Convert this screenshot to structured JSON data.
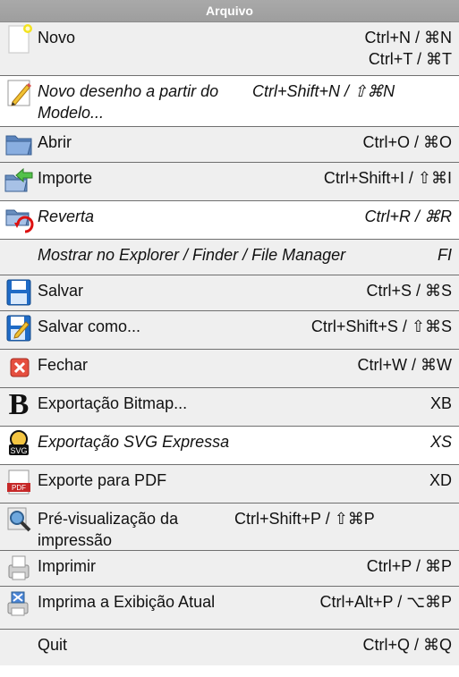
{
  "menu": {
    "title": "Arquivo",
    "items": [
      {
        "label": "Novo",
        "shortcut": "Ctrl+N / ⌘N\nCtrl+T / ⌘T",
        "icon": "new-document-icon",
        "italic": false
      },
      {
        "label": "Novo desenho a partir do Modelo...",
        "shortcut": "Ctrl+Shift+N / ⇧⌘N",
        "icon": "pencil-template-icon",
        "italic": true
      },
      {
        "label": "Abrir",
        "shortcut": "Ctrl+O / ⌘O",
        "icon": "open-folder-icon",
        "italic": false
      },
      {
        "label": "Importe",
        "shortcut": "Ctrl+Shift+I / ⇧⌘I",
        "icon": "import-arrow-folder-icon",
        "italic": false
      },
      {
        "label": "Reverta",
        "shortcut": "Ctrl+R / ⌘R",
        "icon": "revert-icon",
        "italic": true
      },
      {
        "label": "Mostrar no Explorer / Finder / File Manager",
        "shortcut": "FI",
        "icon": "",
        "italic": true
      },
      {
        "label": "Salvar",
        "shortcut": "Ctrl+S / ⌘S",
        "icon": "save-disk-icon",
        "italic": false
      },
      {
        "label": "Salvar como...",
        "shortcut": "Ctrl+Shift+S / ⇧⌘S",
        "icon": "save-as-icon",
        "italic": false
      },
      {
        "label": "Fechar",
        "shortcut": "Ctrl+W / ⌘W",
        "icon": "close-x-icon",
        "italic": false
      },
      {
        "label": "Exportação Bitmap...",
        "shortcut": "XB",
        "icon": "bitmap-b-icon",
        "italic": false
      },
      {
        "label": "Exportação SVG Expressa",
        "shortcut": "XS",
        "icon": "svg-export-icon",
        "italic": true
      },
      {
        "label": "Exporte para PDF",
        "shortcut": "XD",
        "icon": "pdf-icon",
        "italic": false
      },
      {
        "label": "Pré-visualização da impressão",
        "shortcut": "Ctrl+Shift+P / ⇧⌘P",
        "icon": "print-preview-icon",
        "italic": false
      },
      {
        "label": "Imprimir",
        "shortcut": "Ctrl+P / ⌘P",
        "icon": "printer-icon",
        "italic": false
      },
      {
        "label": "Imprima a Exibição Atual",
        "shortcut": "Ctrl+Alt+P / ⌥⌘P",
        "icon": "print-current-view-icon",
        "italic": false
      },
      {
        "label": "Quit",
        "shortcut": "Ctrl+Q / ⌘Q",
        "icon": "",
        "italic": false
      }
    ]
  },
  "colors": {
    "header_bg": "#a6a6a6",
    "row_bg": "#efefef",
    "row_alt_bg": "#ffffff",
    "divider": "#6f6f6f"
  }
}
